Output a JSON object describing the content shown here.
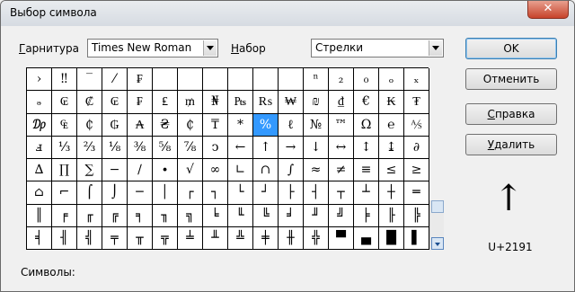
{
  "window": {
    "title": "Выбор символа",
    "close_glyph": "✕"
  },
  "font": {
    "label": "Гарнитура",
    "label_underline": "Г",
    "label_rest": "арнитура",
    "value": "Times New Roman"
  },
  "subset": {
    "label": "Набор",
    "label_underline": "Н",
    "label_rest": "абор",
    "value": "Стрелки"
  },
  "buttons": {
    "ok": "OK",
    "cancel": "Отменить",
    "help_underline": "С",
    "help_rest": "правка",
    "delete_underline": "У",
    "delete_rest": "далить"
  },
  "grid": {
    "selected_index": 41,
    "cells": [
      "›",
      "‼",
      "‾",
      "⁄",
      "₣",
      "",
      "",
      "",
      "",
      "",
      "",
      "ⁿ",
      "₂",
      "₀",
      "ₒ",
      "ₓ",
      "ₔ",
      "₢",
      "₡",
      "₢",
      "₣",
      "₤",
      "₥",
      "₦",
      "₧",
      "₨",
      "₩",
      "₪",
      "₫",
      "€",
      "₭",
      "₮",
      "₯",
      "₠",
      "₵",
      "₲",
      "₳",
      "₴",
      "₵",
      "₸",
      "*",
      "%",
      "ℓ",
      "№",
      "™",
      "Ω",
      "℮",
      "⅍",
      "ⅎ",
      "⅓",
      "⅔",
      "⅛",
      "⅜",
      "⅝",
      "⅞",
      "ↄ",
      "←",
      "↑",
      "→",
      "↓",
      "↔",
      "↕",
      "↨",
      "∂",
      "∆",
      "∏",
      "∑",
      "−",
      "∕",
      "∙",
      "√",
      "∞",
      "∟",
      "∩",
      "∫",
      "≈",
      "≠",
      "≡",
      "≤",
      "≥",
      "⌂",
      "⌐",
      "⌠",
      "⌡",
      "─",
      "│",
      "┌",
      "┐",
      "└",
      "┘",
      "├",
      "┤",
      "┬",
      "┴",
      "┼",
      "═",
      "║",
      "╒",
      "╓",
      "╔",
      "╕",
      "╖",
      "╗",
      "╘",
      "╙",
      "╚",
      "╛",
      "╜",
      "╝",
      "╞",
      "╟",
      "╠",
      "╡",
      "╢",
      "╣",
      "╤",
      "╥",
      "╦",
      "╧",
      "╨",
      "╩",
      "╪",
      "╫",
      "╬",
      "▀",
      "▄",
      "█",
      "▌"
    ]
  },
  "preview": {
    "glyph": "↑",
    "code": "U+2191"
  },
  "symbols": {
    "label": "Символы:"
  }
}
